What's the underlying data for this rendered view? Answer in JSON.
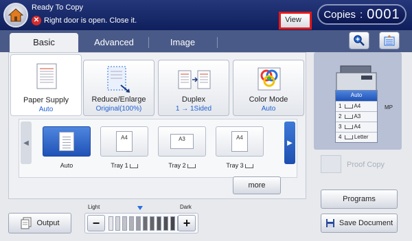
{
  "header": {
    "status_title": "Ready To Copy",
    "status_message": "Right door is open. Close it.",
    "error_icon_glyph": "✕",
    "view_label": "View",
    "copies_label": "Copies",
    "copies_separator": ":",
    "copies_value": "0001"
  },
  "tabs": [
    {
      "label": "Basic",
      "active": true
    },
    {
      "label": "Advanced",
      "active": false
    },
    {
      "label": "Image",
      "active": false
    }
  ],
  "functions": [
    {
      "label": "Paper Supply",
      "value": "Auto"
    },
    {
      "label": "Reduce/Enlarge",
      "value": "Original(100%)"
    },
    {
      "label": "Duplex",
      "value": "1 → 1Sided"
    },
    {
      "label": "Color Mode",
      "value": "Auto"
    }
  ],
  "trays": [
    {
      "label": "Auto",
      "paper": "",
      "selected": true
    },
    {
      "label": "Tray 1",
      "paper": "A4",
      "selected": false
    },
    {
      "label": "Tray 2",
      "paper": "A3",
      "selected": false
    },
    {
      "label": "Tray 3",
      "paper": "A4",
      "selected": false
    }
  ],
  "more_label": "more",
  "machine_trays": [
    {
      "label": "Auto"
    },
    {
      "num": "1",
      "paper": "A4"
    },
    {
      "num": "2",
      "paper": "A3"
    },
    {
      "num": "3",
      "paper": "A4"
    },
    {
      "num": "4",
      "paper": "Letter"
    }
  ],
  "mp_label": "MP",
  "proof_copy_label": "Proof Copy",
  "programs_label": "Programs",
  "save_document_label": "Save Document",
  "output_label": "Output",
  "density": {
    "light_label": "Light",
    "dark_label": "Dark",
    "minus": "−",
    "plus": "+",
    "level": 5,
    "steps": 11
  },
  "colors": {
    "header": "#1a2a6c",
    "accent": "#2a6fdc",
    "highlight": "#e21a1a"
  }
}
